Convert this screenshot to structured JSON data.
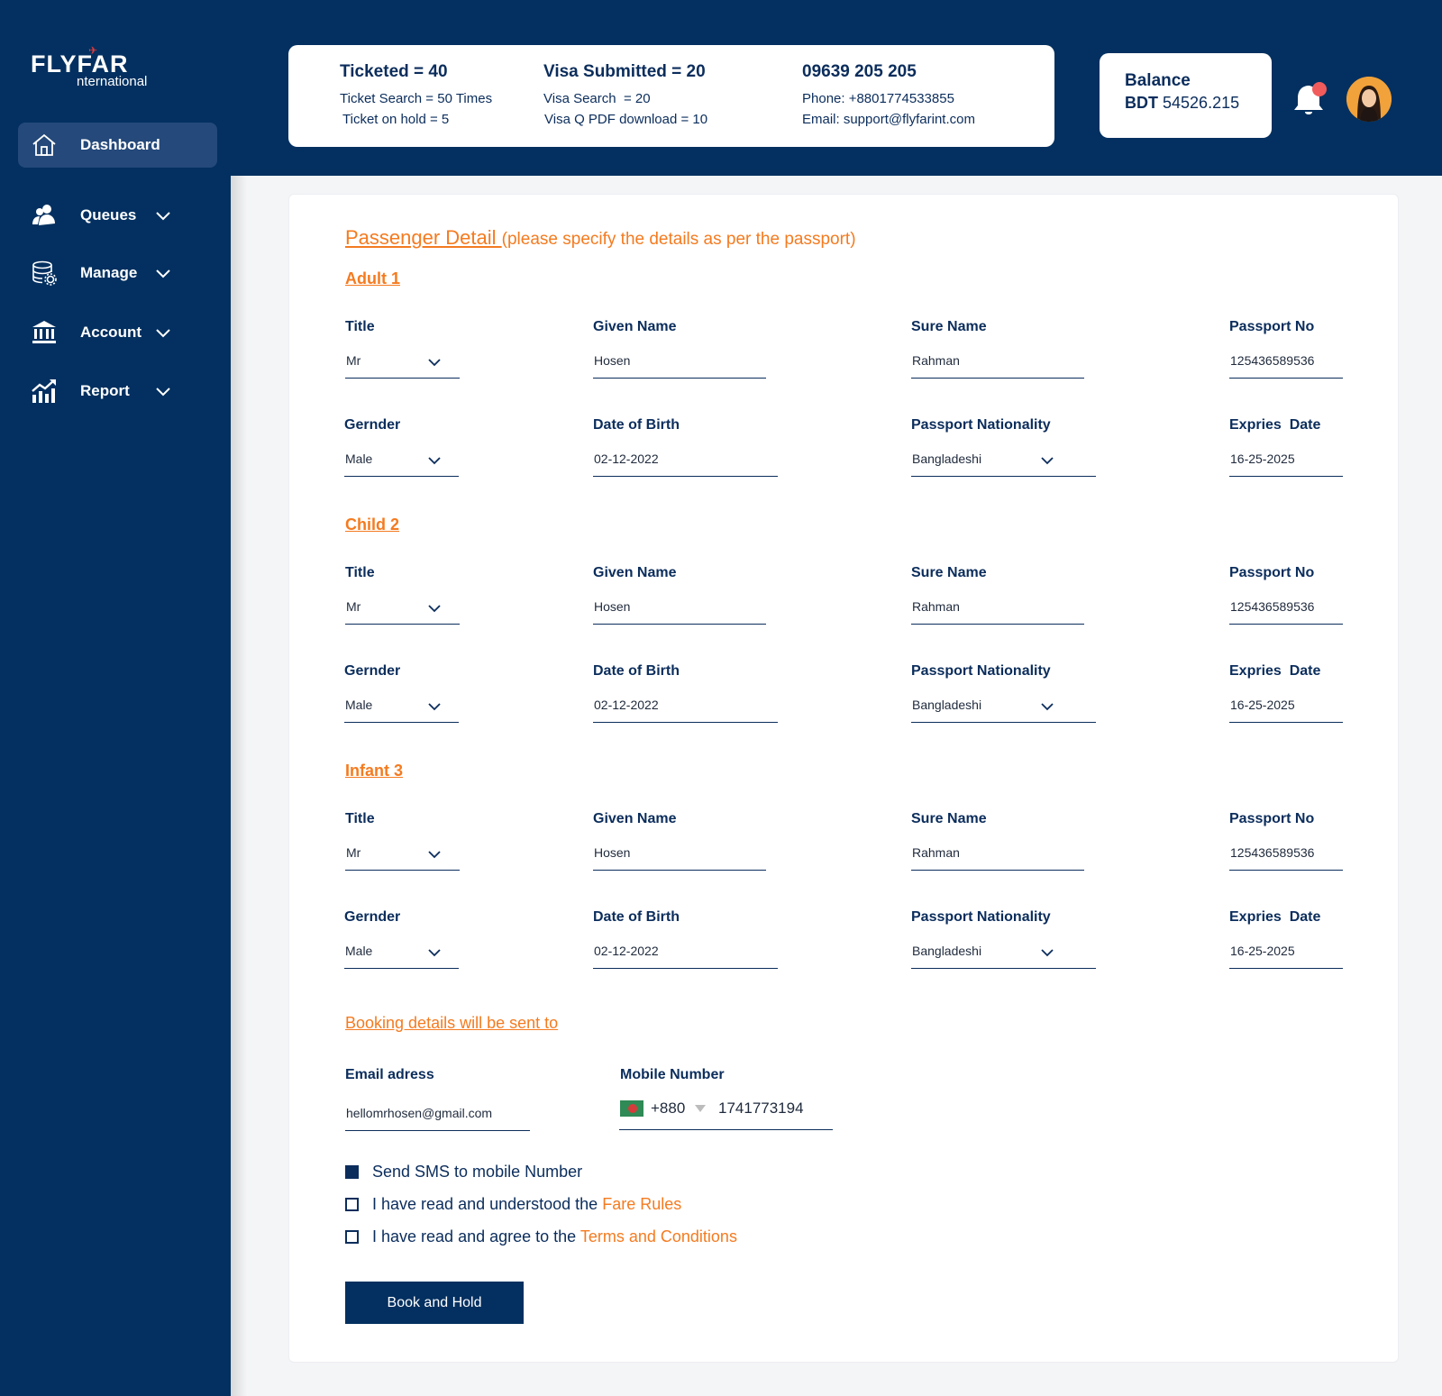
{
  "logo": {
    "top": "FLYFAR",
    "bottom": "nternational"
  },
  "sidebar": {
    "items": [
      {
        "label": "Dashboard",
        "icon": "home-icon",
        "active": true
      },
      {
        "label": "Queues",
        "icon": "users-icon"
      },
      {
        "label": "Manage",
        "icon": "database-gear-icon"
      },
      {
        "label": "Account",
        "icon": "bank-icon"
      },
      {
        "label": "Report",
        "icon": "chart-up-icon"
      }
    ]
  },
  "stats": {
    "ticketed": "Ticketed = 40",
    "ticket_search": "Ticket Search = 50 Times",
    "ticket_hold": "Ticket on hold = 5",
    "visa_submitted": "Visa Submitted = 20",
    "visa_search": "Visa Search  = 20",
    "visa_pdf": "Visa Q PDF download = 10",
    "hotline": "09639 205 205",
    "phone": "Phone: +8801774533855",
    "email": "Email: support@flyfarint.com"
  },
  "balance": {
    "title": "Balance",
    "currency": "BDT",
    "amount": "54526.215"
  },
  "form": {
    "title": "Passenger Detail ",
    "subtitle": "(please specify the details as per the passport)",
    "labels": {
      "title": "Title",
      "given_name": "Given Name",
      "surname": "Sure Name",
      "passport_no": "Passport No",
      "gender": "Gernder",
      "dob": "Date of Birth",
      "nationality": "Passport Nationality",
      "expiry": "Expries  Date"
    },
    "passengers": [
      {
        "heading": "Adult 1",
        "title": "Mr",
        "given_name": "Hosen",
        "surname": "Rahman",
        "passport_no": "125436589536",
        "gender": "Male",
        "dob": "02-12-2022",
        "nationality": "Bangladeshi",
        "expiry": "16-25-2025"
      },
      {
        "heading": "Child 2",
        "title": "Mr",
        "given_name": "Hosen",
        "surname": "Rahman",
        "passport_no": "125436589536",
        "gender": "Male",
        "dob": "02-12-2022",
        "nationality": "Bangladeshi",
        "expiry": "16-25-2025"
      },
      {
        "heading": "Infant 3",
        "title": "Mr",
        "given_name": "Hosen",
        "surname": "Rahman",
        "passport_no": "125436589536",
        "gender": "Male",
        "dob": "02-12-2022",
        "nationality": "Bangladeshi",
        "expiry": "16-25-2025"
      }
    ]
  },
  "booking": {
    "heading": "Booking details will be sent to",
    "email_label": "Email adress",
    "email_value": "hellomrhosen@gmail.com",
    "mobile_label": "Mobile Number",
    "country_code": "+880",
    "mobile_value": "1741773194",
    "checks": [
      {
        "text": "Send SMS to mobile Number",
        "link": "",
        "checked": true
      },
      {
        "text": "I have read and understood the ",
        "link": "Fare Rules",
        "checked": false
      },
      {
        "text": "I have read and agree to the ",
        "link": "Terms and Conditions",
        "checked": false
      }
    ],
    "submit_label": "Book and Hold"
  },
  "colors": {
    "navy": "#033060",
    "accent": "#f47b20",
    "text": "#0b2d5c"
  }
}
